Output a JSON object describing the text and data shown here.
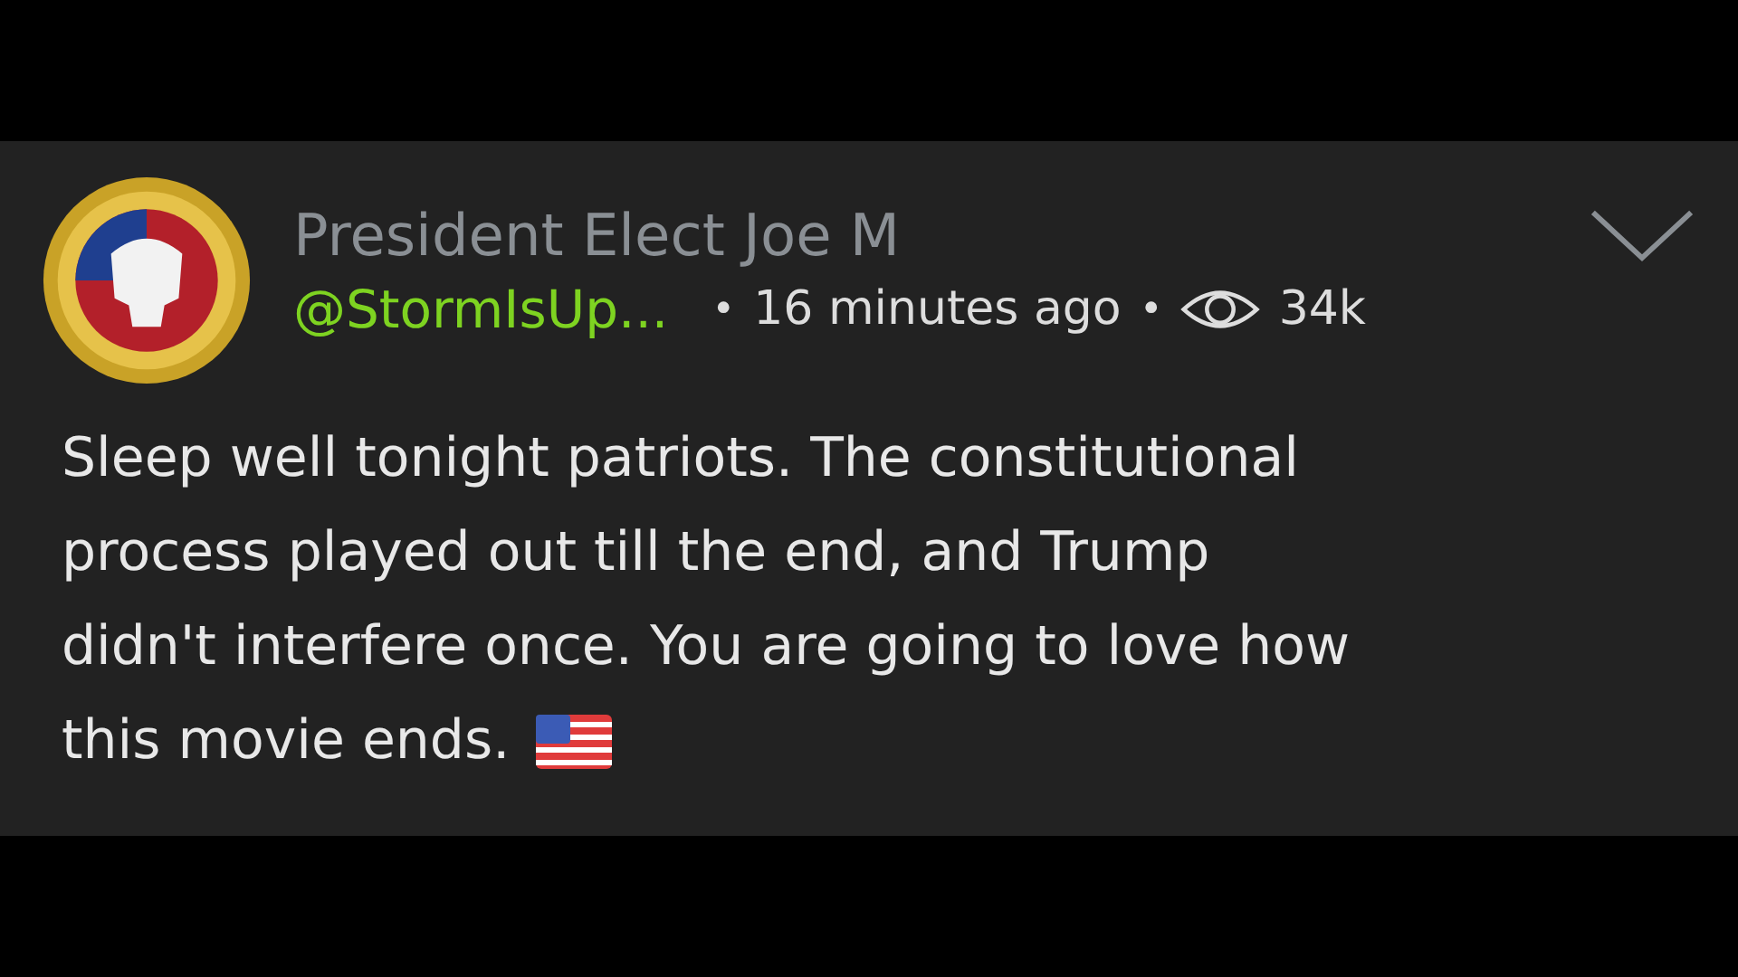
{
  "post": {
    "author": "President Elect Joe M",
    "handle": "@StormIsUp...",
    "separator": "•",
    "time": "16 minutes ago",
    "views": "34k",
    "body_lines": [
      "Sleep well tonight patriots. The constitutional",
      "process played out till the end, and Trump",
      "didn't interfere once. You are going to love how",
      "this movie ends."
    ]
  }
}
